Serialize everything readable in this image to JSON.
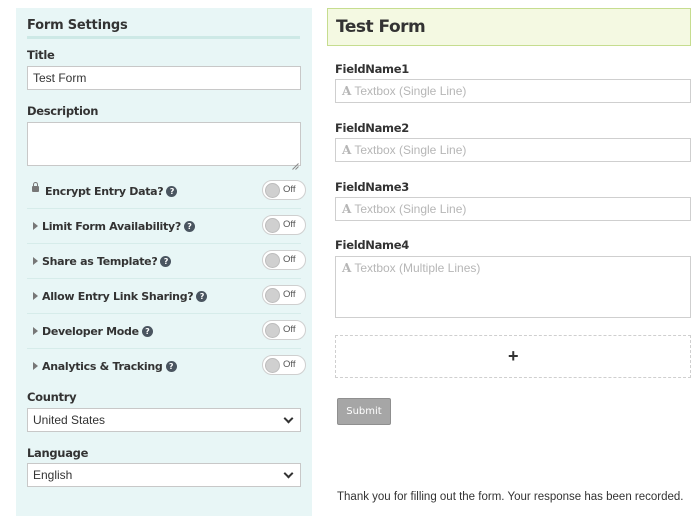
{
  "settings": {
    "heading": "Form Settings",
    "title_label": "Title",
    "title_value": "Test Form",
    "description_label": "Description",
    "description_value": "",
    "options": [
      {
        "label": "Encrypt Entry Data?",
        "state": "Off",
        "icon": "lock-icon"
      },
      {
        "label": "Limit Form Availability?",
        "state": "Off",
        "icon": "caret-right-icon"
      },
      {
        "label": "Share as Template?",
        "state": "Off",
        "icon": "caret-right-icon"
      },
      {
        "label": "Allow Entry Link Sharing?",
        "state": "Off",
        "icon": "caret-right-icon"
      },
      {
        "label": "Developer Mode",
        "state": "Off",
        "icon": "caret-right-icon"
      },
      {
        "label": "Analytics & Tracking",
        "state": "Off",
        "icon": "caret-right-icon"
      }
    ],
    "help_glyph": "?",
    "country_label": "Country",
    "country_value": "United States",
    "language_label": "Language",
    "language_value": "English"
  },
  "form": {
    "title": "Test Form",
    "fields": [
      {
        "label": "FieldName1",
        "icon_glyph": "A",
        "placeholder": "Textbox (Single Line)"
      },
      {
        "label": "FieldName2",
        "icon_glyph": "A",
        "placeholder": "Textbox (Single Line)"
      },
      {
        "label": "FieldName3",
        "icon_glyph": "A",
        "placeholder": "Textbox (Single Line)"
      },
      {
        "label": "FieldName4",
        "icon_glyph": "A",
        "placeholder": "Textbox (Multiple Lines)"
      }
    ],
    "add_glyph": "+",
    "submit_label": "Submit",
    "confirmation": "Thank you for filling out the form. Your response has been recorded."
  },
  "colors": {
    "settings_bg": "#e8f6f6",
    "form_header_bg": "#f4f9e2",
    "form_header_border": "#c6dd8f",
    "submit_bg": "#a6a6a6"
  }
}
